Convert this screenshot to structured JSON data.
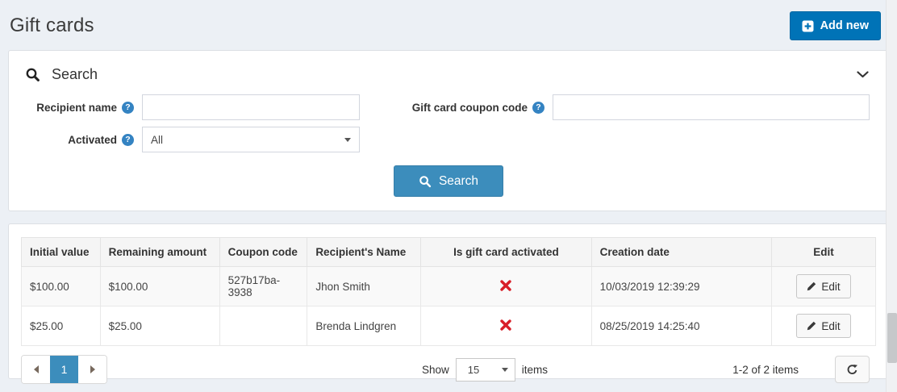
{
  "page": {
    "title": "Gift cards"
  },
  "toolbar": {
    "add_new_label": "Add new"
  },
  "search_panel": {
    "title": "Search",
    "recipient_name": {
      "label": "Recipient name",
      "value": ""
    },
    "coupon_code": {
      "label": "Gift card coupon code",
      "value": ""
    },
    "activated": {
      "label": "Activated",
      "value": "All"
    },
    "search_button_label": "Search"
  },
  "grid": {
    "columns": [
      "Initial value",
      "Remaining amount",
      "Coupon code",
      "Recipient's Name",
      "Is gift card activated",
      "Creation date",
      "Edit"
    ],
    "rows": [
      {
        "initial_value": "$100.00",
        "remaining_amount": "$100.00",
        "coupon_code": "527b17ba-3938",
        "recipient_name": "Jhon Smith",
        "activated": false,
        "creation_date": "10/03/2019 12:39:29",
        "edit_label": "Edit"
      },
      {
        "initial_value": "$25.00",
        "remaining_amount": "$25.00",
        "coupon_code": "",
        "recipient_name": "Brenda Lindgren",
        "activated": false,
        "creation_date": "08/25/2019 14:25:40",
        "edit_label": "Edit"
      }
    ],
    "pager": {
      "current_page": "1",
      "show_label": "Show",
      "page_size": "15",
      "items_label": "items",
      "range_text": "1-2 of 2 items"
    }
  },
  "icons": {
    "help_glyph": "?",
    "add_new": "plus-square",
    "search": "magnifier",
    "collapse": "chevron-down",
    "help": "question-circle",
    "not_activated": "red-x",
    "edit": "pencil",
    "prev_page": "left-triangle",
    "next_page": "right-triangle",
    "refresh": "rotate-arrow"
  },
  "colors": {
    "page_background": "#ecf0f5",
    "panel_background": "#ffffff",
    "add_new_button": "#0073b7",
    "search_button": "#3c8dbc",
    "active_page": "#3c8dbc",
    "not_activated_red": "#d81e28",
    "header_row_background": "#f5f5f5",
    "text": "#333333"
  }
}
